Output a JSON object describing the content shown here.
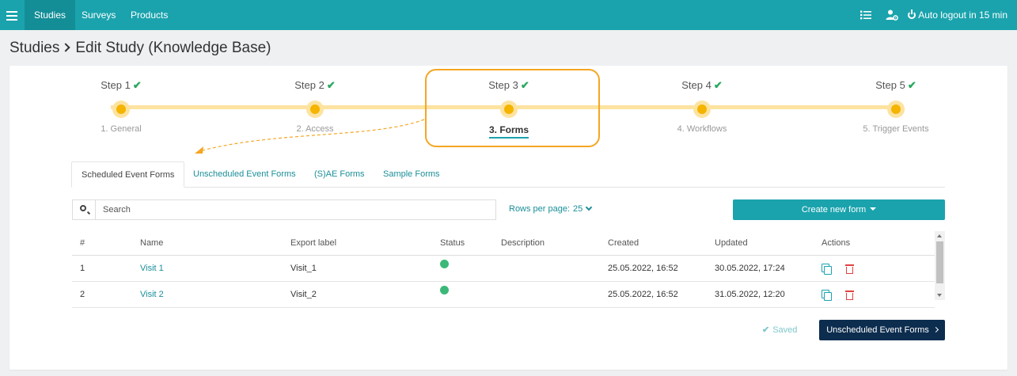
{
  "topbar": {
    "nav": [
      "Studies",
      "Surveys",
      "Products"
    ],
    "active_nav": "Studies",
    "autologout": "Auto logout in 15 min"
  },
  "breadcrumb": {
    "parent": "Studies",
    "current": "Edit Study (Knowledge Base)"
  },
  "steps": [
    {
      "label": "Step 1",
      "check": "✔",
      "sub": "1. General"
    },
    {
      "label": "Step 2",
      "check": "✔",
      "sub": "2. Access"
    },
    {
      "label": "Step 3",
      "check": "✔",
      "sub": "3. Forms"
    },
    {
      "label": "Step 4",
      "check": "✔",
      "sub": "4. Workflows"
    },
    {
      "label": "Step 5",
      "check": "✔",
      "sub": "5. Trigger Events"
    }
  ],
  "current_step": 3,
  "tabs": [
    "Scheduled Event Forms",
    "Unscheduled Event Forms",
    "(S)AE Forms",
    "Sample Forms"
  ],
  "active_tab": "Scheduled Event Forms",
  "search": {
    "placeholder": "Search",
    "value": ""
  },
  "rows_per_page": {
    "label": "Rows per page:",
    "value": "25"
  },
  "create_button": "Create new form",
  "table": {
    "headers": [
      "#",
      "Name",
      "Export label",
      "Status",
      "Description",
      "Created",
      "Updated",
      "Actions"
    ],
    "rows": [
      {
        "num": "1",
        "name": "Visit 1",
        "export": "Visit_1",
        "status": "active",
        "description": "",
        "created": "25.05.2022, 16:52",
        "updated": "30.05.2022, 17:24"
      },
      {
        "num": "2",
        "name": "Visit 2",
        "export": "Visit_2",
        "status": "active",
        "description": "",
        "created": "25.05.2022, 16:52",
        "updated": "31.05.2022, 12:20"
      }
    ]
  },
  "footer": {
    "saved": "Saved",
    "next_button": "Unscheduled Event Forms"
  },
  "colors": {
    "primary": "#1aa3ad",
    "step_dot": "#f5b400",
    "status_active": "#3bb878",
    "delete": "#e04040",
    "dark_button": "#0d2d4f",
    "highlight": "#f5a623"
  }
}
